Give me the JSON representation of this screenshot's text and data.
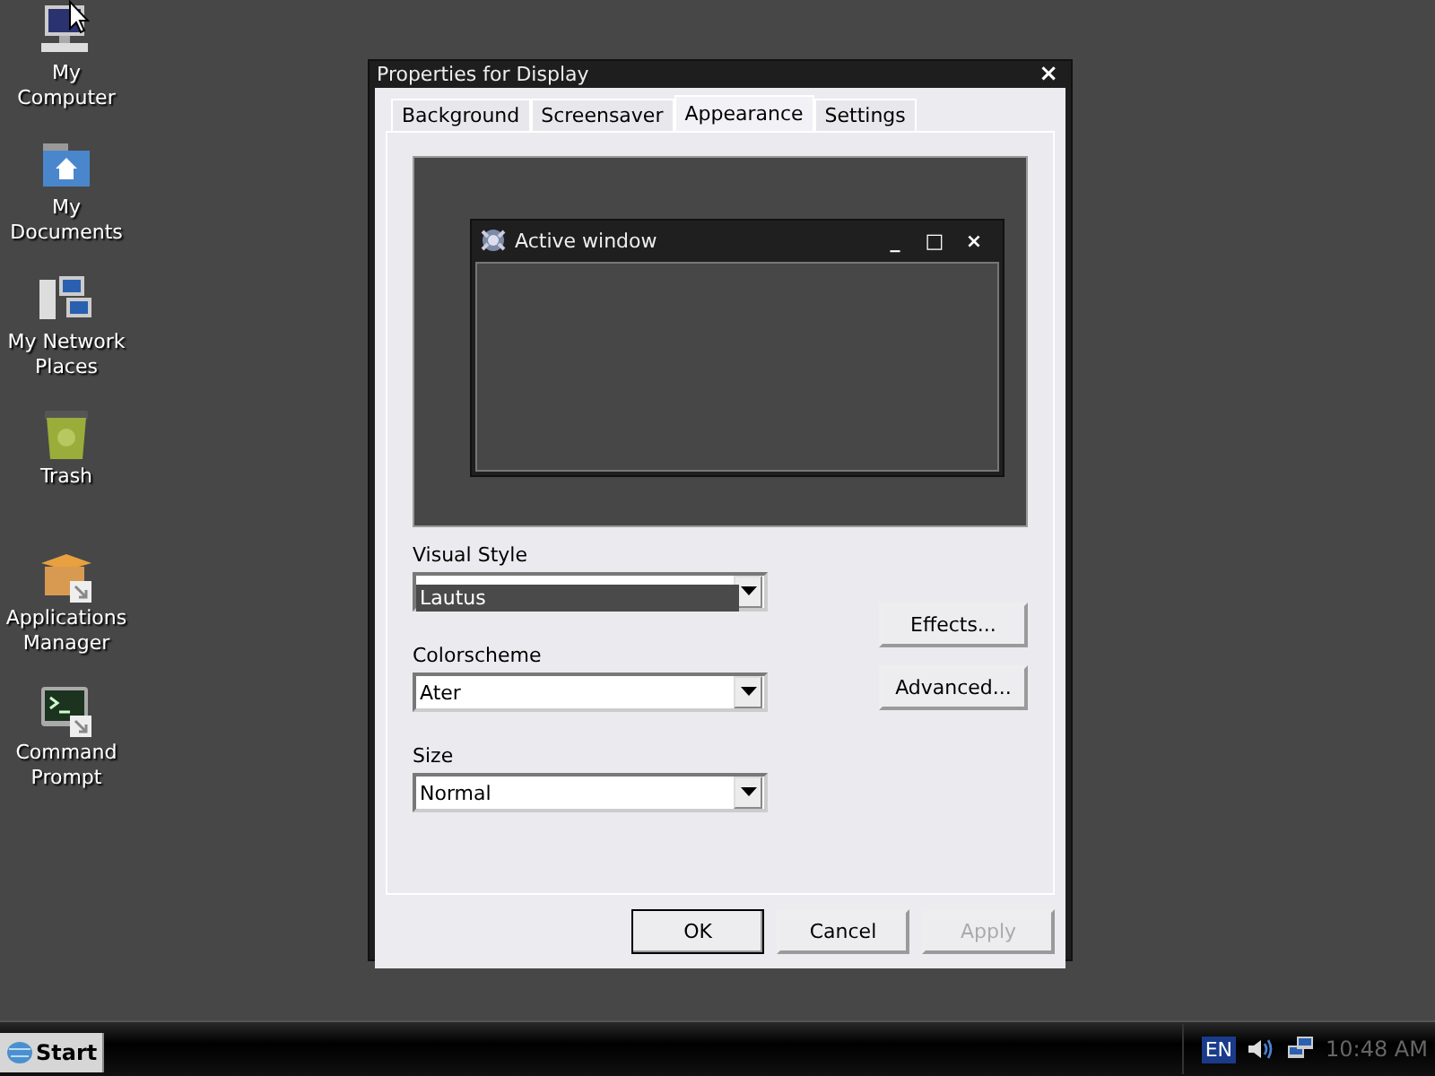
{
  "desktop_icons": [
    {
      "kind": "computer",
      "label": "My Computer"
    },
    {
      "kind": "documents",
      "label": "My Documents"
    },
    {
      "kind": "network",
      "label": "My Network Places"
    },
    {
      "kind": "trash",
      "label": "Trash"
    },
    {
      "kind": "package",
      "label": "Applications Manager"
    },
    {
      "kind": "terminal",
      "label": "Command Prompt"
    }
  ],
  "dialog": {
    "title": "Properties for Display",
    "close": "×",
    "tabs": [
      {
        "label": "Background",
        "selected": false
      },
      {
        "label": "Screensaver",
        "selected": false
      },
      {
        "label": "Appearance",
        "selected": true
      },
      {
        "label": "Settings",
        "selected": false
      }
    ],
    "preview": {
      "title": "Active window",
      "buttons": [
        "_",
        "□",
        "×"
      ]
    },
    "fields": [
      {
        "label": "Visual Style",
        "open_list": [
          {
            "label": "Lautus",
            "selected": true
          }
        ]
      },
      {
        "label": "Colorscheme",
        "value": "Ater"
      },
      {
        "label": "Size",
        "value": "Normal"
      }
    ],
    "side_buttons": [
      {
        "label": "Effects...",
        "disabled": false
      },
      {
        "label": "Advanced...",
        "disabled": false
      }
    ],
    "buttons": [
      {
        "label": "OK",
        "default": true,
        "disabled": false
      },
      {
        "label": "Cancel",
        "default": false,
        "disabled": false
      },
      {
        "label": "Apply",
        "default": false,
        "disabled": true
      }
    ]
  },
  "taskbar": {
    "start": "Start",
    "language": "EN",
    "clock": "10:48 AM"
  }
}
